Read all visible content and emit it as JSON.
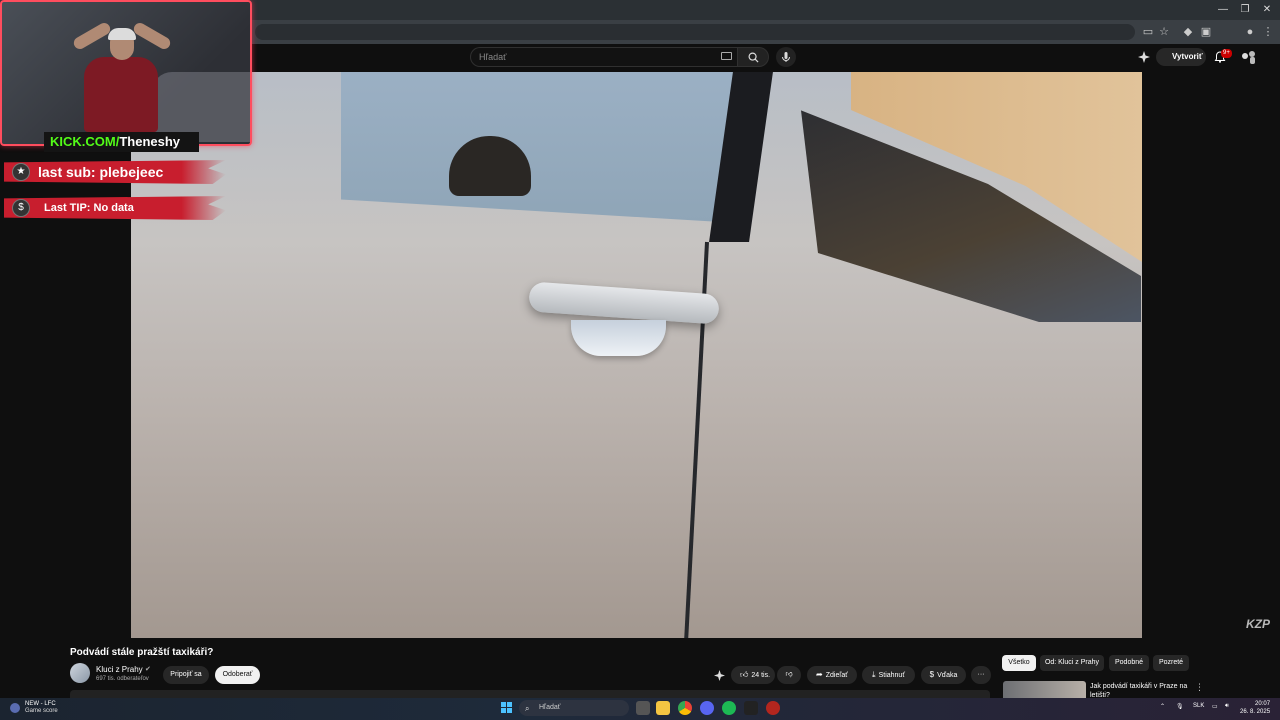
{
  "youtube": {
    "search_placeholder": "Hľadať",
    "create_label": "Vytvoriť",
    "notification_count": "9+"
  },
  "overlay": {
    "kick_prefix": "KICK.COM/",
    "kick_channel": "Theneshy",
    "last_sub": "last sub: plebejeec",
    "last_tip": "Last TIP: No data"
  },
  "video": {
    "watermark": "KZP",
    "title": "Podvádí stále pražští taxikáři?",
    "channel_name": "Kluci z Prahy",
    "subscribers": "697 tis. odberateľov",
    "join_label": "Pripojiť sa",
    "subscribe_label": "Odoberať",
    "likes": "24 tis.",
    "share_label": "Zdieľať",
    "download_label": "Stiahnuť",
    "thanks_label": "Vďaka"
  },
  "sidebar": {
    "chips": [
      "Všetko",
      "Od: Kluci z Prahy",
      "Podobné",
      "Pozreté"
    ],
    "recommendation_title": "Jak podvádí taxikáři v Praze na letišti?"
  },
  "taskbar": {
    "news_title": "NEW - LFC",
    "news_sub": "Game score",
    "search_placeholder": "Hľadať",
    "language": "SLK",
    "time": "20:07",
    "date": "26. 8. 2025"
  }
}
